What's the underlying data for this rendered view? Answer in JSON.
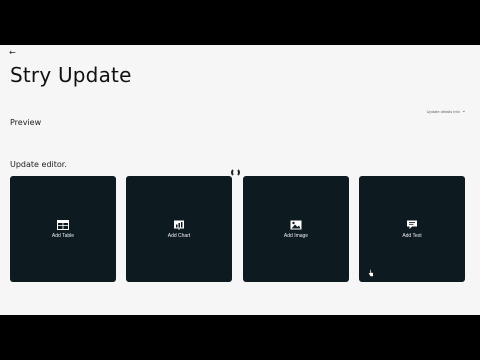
{
  "header": {
    "back_icon": "arrow-left-icon",
    "title": "Stry Update",
    "update_info": "Update details info",
    "update_info_icon": "chevron-down-icon"
  },
  "preview": {
    "label": "Preview"
  },
  "editor": {
    "label": "Update editor.",
    "loading_icon": "spinner-icon",
    "cards": [
      {
        "label": "Add Table",
        "icon": "table-icon"
      },
      {
        "label": "Add Chart",
        "icon": "chart-icon"
      },
      {
        "label": "Add Image",
        "icon": "image-icon"
      },
      {
        "label": "Add Text",
        "icon": "text-bubble-icon"
      }
    ]
  },
  "colors": {
    "background": "#f6f6f6",
    "card": "#0d1a1f",
    "card_text": "#f0f0f0",
    "letterbox": "#000000"
  }
}
